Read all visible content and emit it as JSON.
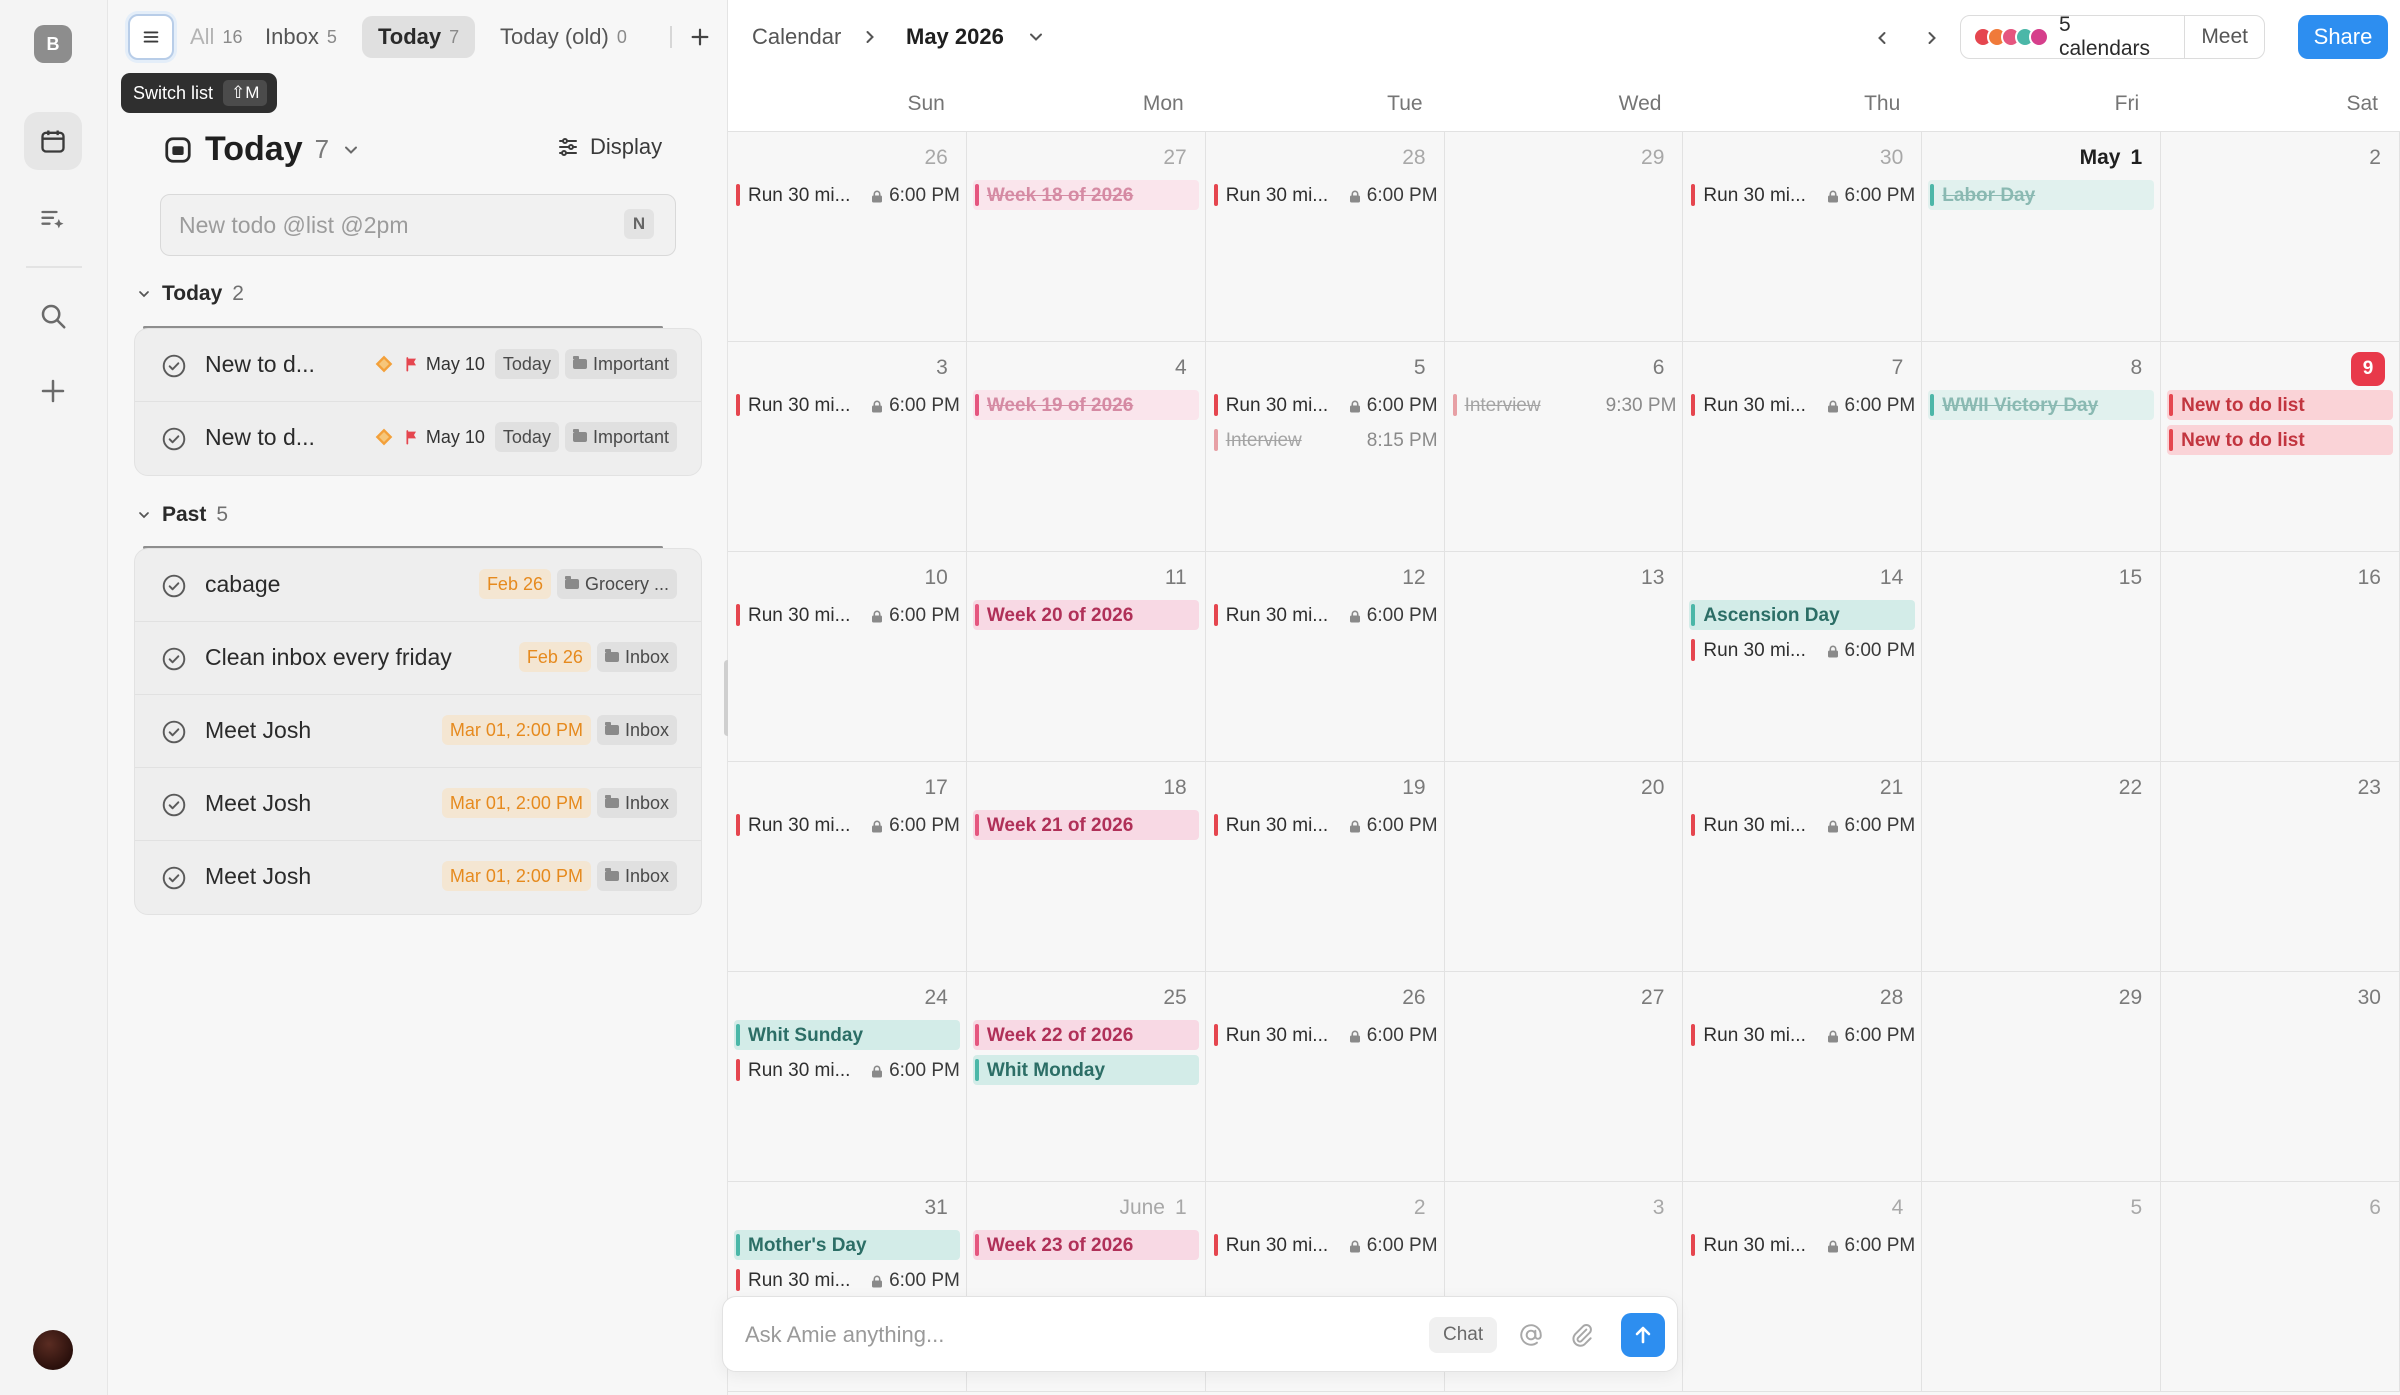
{
  "rail": {
    "workspace_initial": "B"
  },
  "tabs": [
    {
      "label": "All",
      "count": "16"
    },
    {
      "label": "Inbox",
      "count": "5"
    },
    {
      "label": "Today",
      "count": "7"
    },
    {
      "label": "Today (old)",
      "count": "0"
    }
  ],
  "tooltip": {
    "label": "Switch list",
    "shortcut": "⇧M"
  },
  "list": {
    "title": "Today",
    "count": "7",
    "display_label": "Display",
    "new_todo_placeholder": "New todo @list @2pm",
    "new_todo_shortcut": "N"
  },
  "sections": [
    {
      "label": "Today",
      "count": "2",
      "items": [
        {
          "label": "New to d...",
          "date": "May 10",
          "tags": [
            "Today",
            "Important"
          ]
        },
        {
          "label": "New to d...",
          "date": "May 10",
          "tags": [
            "Today",
            "Important"
          ]
        }
      ]
    },
    {
      "label": "Past",
      "count": "5",
      "items": [
        {
          "label": "cabage",
          "date": "Feb 26",
          "tags": [
            "Grocery ..."
          ]
        },
        {
          "label": "Clean inbox every friday",
          "date": "Feb 26",
          "tags": [
            "Inbox"
          ]
        },
        {
          "label": "Meet Josh",
          "date": "Mar 01, 2:00 PM",
          "tags": [
            "Inbox"
          ]
        },
        {
          "label": "Meet Josh",
          "date": "Mar 01, 2:00 PM",
          "tags": [
            "Inbox"
          ]
        },
        {
          "label": "Meet Josh",
          "date": "Mar 01, 2:00 PM",
          "tags": [
            "Inbox"
          ]
        }
      ]
    }
  ],
  "calendar": {
    "breadcrumb": "Calendar",
    "month": "May 2026",
    "calendars_label": "5 calendars",
    "calendar_colors": [
      "#e5464f",
      "#f07a3a",
      "#e5567f",
      "#4bb7a8",
      "#d63f8c"
    ],
    "meet_label": "Meet",
    "share_label": "Share",
    "weekdays": [
      "Sun",
      "Mon",
      "Tue",
      "Wed",
      "Thu",
      "Fri",
      "Sat"
    ],
    "weeks": [
      [
        {
          "day": "26",
          "muted": true,
          "events": [
            {
              "kind": "run",
              "title": "Run 30 mi...",
              "time": "6:00 PM",
              "lock": true
            }
          ]
        },
        {
          "day": "27",
          "muted": true,
          "events": [
            {
              "kind": "pink-done",
              "title": "Week 18 of 2026"
            }
          ]
        },
        {
          "day": "28",
          "muted": true,
          "events": [
            {
              "kind": "run",
              "title": "Run 30 mi...",
              "time": "6:00 PM",
              "lock": true
            }
          ]
        },
        {
          "day": "29",
          "muted": true,
          "events": []
        },
        {
          "day": "30",
          "muted": true,
          "events": [
            {
              "kind": "run",
              "title": "Run 30 mi...",
              "time": "6:00 PM",
              "lock": true
            }
          ]
        },
        {
          "day": "1",
          "month": "May",
          "bold": true,
          "events": [
            {
              "kind": "teal-done",
              "title": "Labor Day"
            }
          ]
        },
        {
          "day": "2",
          "events": []
        }
      ],
      [
        {
          "day": "3",
          "events": [
            {
              "kind": "run",
              "title": "Run 30 mi...",
              "time": "6:00 PM",
              "lock": true
            }
          ]
        },
        {
          "day": "4",
          "events": [
            {
              "kind": "pink-done",
              "title": "Week 19 of 2026"
            }
          ]
        },
        {
          "day": "5",
          "events": [
            {
              "kind": "run",
              "title": "Run 30 mi...",
              "time": "6:00 PM",
              "lock": true
            },
            {
              "kind": "strike",
              "title": "Interview",
              "time": "8:15 PM"
            }
          ]
        },
        {
          "day": "6",
          "events": [
            {
              "kind": "strike",
              "title": "Interview",
              "time": "9:30 PM"
            }
          ]
        },
        {
          "day": "7",
          "events": [
            {
              "kind": "run",
              "title": "Run 30 mi...",
              "time": "6:00 PM",
              "lock": true
            }
          ]
        },
        {
          "day": "8",
          "events": [
            {
              "kind": "teal-done",
              "title": "WWII Victory Day"
            }
          ]
        },
        {
          "day": "9",
          "today": true,
          "events": [
            {
              "kind": "red",
              "title": "New to do list"
            },
            {
              "kind": "red",
              "title": "New to do list"
            }
          ]
        }
      ],
      [
        {
          "day": "10",
          "events": [
            {
              "kind": "run",
              "title": "Run 30 mi...",
              "time": "6:00 PM",
              "lock": true
            }
          ]
        },
        {
          "day": "11",
          "events": [
            {
              "kind": "pink",
              "title": "Week 20 of 2026"
            }
          ]
        },
        {
          "day": "12",
          "events": [
            {
              "kind": "run",
              "title": "Run 30 mi...",
              "time": "6:00 PM",
              "lock": true
            }
          ]
        },
        {
          "day": "13",
          "events": []
        },
        {
          "day": "14",
          "events": [
            {
              "kind": "teal",
              "title": "Ascension Day"
            },
            {
              "kind": "run",
              "title": "Run 30 mi...",
              "time": "6:00 PM",
              "lock": true
            }
          ]
        },
        {
          "day": "15",
          "events": []
        },
        {
          "day": "16",
          "events": []
        }
      ],
      [
        {
          "day": "17",
          "events": [
            {
              "kind": "run",
              "title": "Run 30 mi...",
              "time": "6:00 PM",
              "lock": true
            }
          ]
        },
        {
          "day": "18",
          "events": [
            {
              "kind": "pink",
              "title": "Week 21 of 2026"
            }
          ]
        },
        {
          "day": "19",
          "events": [
            {
              "kind": "run",
              "title": "Run 30 mi...",
              "time": "6:00 PM",
              "lock": true
            }
          ]
        },
        {
          "day": "20",
          "events": []
        },
        {
          "day": "21",
          "events": [
            {
              "kind": "run",
              "title": "Run 30 mi...",
              "time": "6:00 PM",
              "lock": true
            }
          ]
        },
        {
          "day": "22",
          "events": []
        },
        {
          "day": "23",
          "events": []
        }
      ],
      [
        {
          "day": "24",
          "events": [
            {
              "kind": "teal",
              "title": "Whit Sunday"
            },
            {
              "kind": "run",
              "title": "Run 30 mi...",
              "time": "6:00 PM",
              "lock": true
            }
          ]
        },
        {
          "day": "25",
          "events": [
            {
              "kind": "pink",
              "title": "Week 22 of 2026"
            },
            {
              "kind": "teal",
              "title": "Whit Monday"
            }
          ]
        },
        {
          "day": "26",
          "events": [
            {
              "kind": "run",
              "title": "Run 30 mi...",
              "time": "6:00 PM",
              "lock": true
            }
          ]
        },
        {
          "day": "27",
          "events": []
        },
        {
          "day": "28",
          "events": [
            {
              "kind": "run",
              "title": "Run 30 mi...",
              "time": "6:00 PM",
              "lock": true
            }
          ]
        },
        {
          "day": "29",
          "events": []
        },
        {
          "day": "30",
          "events": []
        }
      ],
      [
        {
          "day": "31",
          "events": [
            {
              "kind": "teal",
              "title": "Mother's Day"
            },
            {
              "kind": "run",
              "title": "Run 30 mi...",
              "time": "6:00 PM",
              "lock": true
            }
          ]
        },
        {
          "day": "1",
          "month": "June",
          "muted": true,
          "events": [
            {
              "kind": "pink",
              "title": "Week 23 of 2026"
            }
          ]
        },
        {
          "day": "2",
          "muted": true,
          "events": [
            {
              "kind": "run",
              "title": "Run 30 mi...",
              "time": "6:00 PM",
              "lock": true
            }
          ]
        },
        {
          "day": "3",
          "muted": true,
          "events": []
        },
        {
          "day": "4",
          "muted": true,
          "events": [
            {
              "kind": "run",
              "title": "Run 30 mi...",
              "time": "6:00 PM",
              "lock": true
            }
          ]
        },
        {
          "day": "5",
          "muted": true,
          "events": []
        },
        {
          "day": "6",
          "muted": true,
          "events": []
        }
      ]
    ]
  },
  "ask": {
    "placeholder": "Ask Amie anything...",
    "chat_label": "Chat"
  }
}
